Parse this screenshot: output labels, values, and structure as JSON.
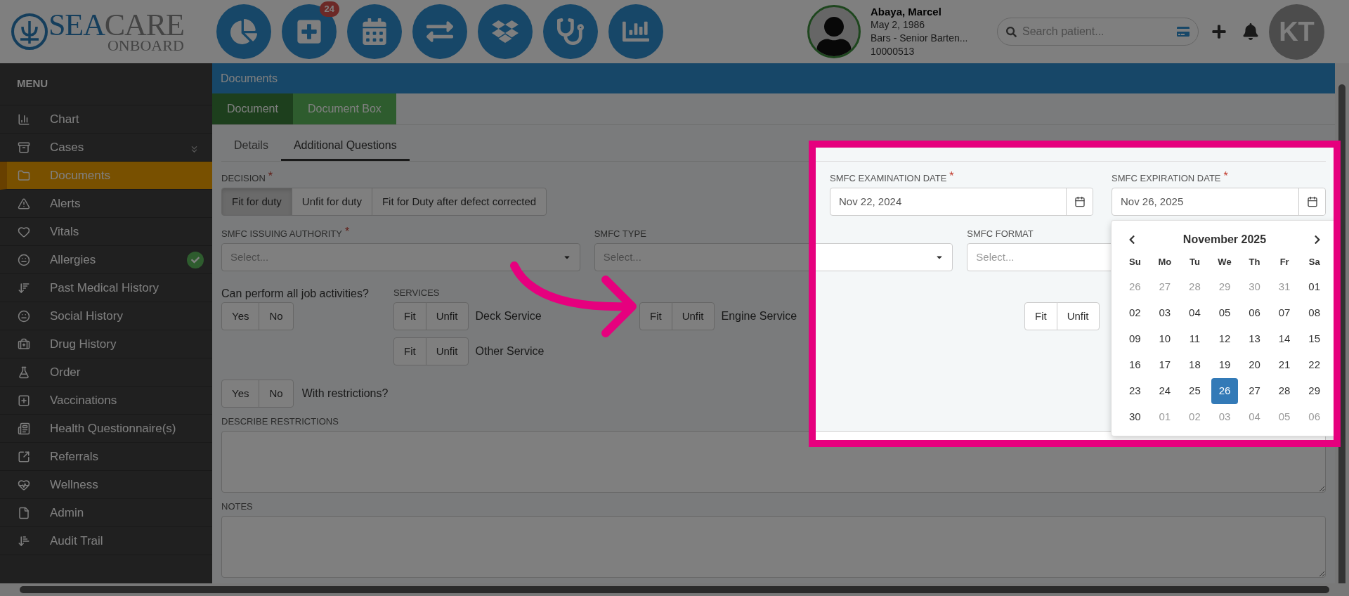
{
  "header": {
    "logo": {
      "first": "SEA",
      "second": "CARE",
      "sub": "ONBOARD"
    },
    "toolbar_badge": "24",
    "patient": {
      "name": "Abaya, Marcel",
      "dob": "May 2, 1986",
      "role": "Bars - Senior Barten...",
      "id": "10000513"
    },
    "search": {
      "placeholder": "Search patient..."
    },
    "user_initials": "KT"
  },
  "sidebar": {
    "title": "MENU",
    "items": [
      {
        "label": "Chart",
        "selected": false,
        "expandable": false,
        "checked": false
      },
      {
        "label": "Cases",
        "selected": false,
        "expandable": true,
        "checked": false
      },
      {
        "label": "Documents",
        "selected": true,
        "expandable": false,
        "checked": false
      },
      {
        "label": "Alerts",
        "selected": false,
        "expandable": false,
        "checked": false
      },
      {
        "label": "Vitals",
        "selected": false,
        "expandable": false,
        "checked": false
      },
      {
        "label": "Allergies",
        "selected": false,
        "expandable": false,
        "checked": true
      },
      {
        "label": "Past Medical History",
        "selected": false,
        "expandable": false,
        "checked": false
      },
      {
        "label": "Social History",
        "selected": false,
        "expandable": false,
        "checked": false
      },
      {
        "label": "Drug History",
        "selected": false,
        "expandable": false,
        "checked": false
      },
      {
        "label": "Order",
        "selected": false,
        "expandable": false,
        "checked": false
      },
      {
        "label": "Vaccinations",
        "selected": false,
        "expandable": false,
        "checked": false
      },
      {
        "label": "Health Questionnaire(s)",
        "selected": false,
        "expandable": false,
        "checked": false
      },
      {
        "label": "Referrals",
        "selected": false,
        "expandable": false,
        "checked": false
      },
      {
        "label": "Wellness",
        "selected": false,
        "expandable": false,
        "checked": false
      },
      {
        "label": "Admin",
        "selected": false,
        "expandable": false,
        "checked": false
      },
      {
        "label": "Audit Trail",
        "selected": false,
        "expandable": false,
        "checked": false
      }
    ]
  },
  "main": {
    "title": "Documents",
    "tabs": [
      {
        "label": "Document",
        "selected": true
      },
      {
        "label": "Document Box",
        "selected": false
      }
    ],
    "subtabs": [
      {
        "label": "Details",
        "selected": false
      },
      {
        "label": "Additional Questions",
        "selected": true
      }
    ],
    "form": {
      "decision": {
        "label": "DECISION",
        "required_mark": "*",
        "options": [
          {
            "label": "Fit for duty",
            "selected": true
          },
          {
            "label": "Unfit for duty",
            "selected": false
          },
          {
            "label": "Fit for Duty after defect corrected",
            "selected": false
          }
        ]
      },
      "examination_date": {
        "label": "SMFC EXAMINATION DATE",
        "required_mark": "*",
        "value": "Nov 22, 2024"
      },
      "expiration_date": {
        "label": "SMFC EXPIRATION DATE",
        "required_mark": "*",
        "value": "Nov 26, 2025"
      },
      "selects": [
        {
          "label": "SMFC ISSUING AUTHORITY",
          "required_mark": "*",
          "placeholder": "Select..."
        },
        {
          "label": "SMFC TYPE",
          "placeholder": "Select..."
        },
        {
          "label": "SMFC FORMAT",
          "placeholder": "Select..."
        }
      ],
      "can_perform": {
        "label": "Can perform all job activities?",
        "options": [
          {
            "label": "Yes",
            "selected": false
          },
          {
            "label": "No",
            "selected": false
          }
        ]
      },
      "services": {
        "label": "SERVICES",
        "groups": [
          {
            "label": "Deck Service",
            "options": [
              {
                "label": "Fit",
                "selected": false
              },
              {
                "label": "Unfit",
                "selected": false
              }
            ]
          },
          {
            "label": "Other Service",
            "options": [
              {
                "label": "Fit",
                "selected": false
              },
              {
                "label": "Unfit",
                "selected": false
              }
            ]
          },
          {
            "label": "Engine Service",
            "options": [
              {
                "label": "Fit",
                "selected": false
              },
              {
                "label": "Unfit",
                "selected": false
              }
            ]
          },
          {
            "options": [
              {
                "label": "Fit",
                "selected": false
              },
              {
                "label": "Unfit",
                "selected": false
              }
            ]
          }
        ]
      },
      "restrictions": {
        "label": "With restrictions?",
        "options": [
          {
            "label": "Yes",
            "selected": false
          },
          {
            "label": "No",
            "selected": false
          }
        ]
      },
      "describe_restrictions": {
        "label": "DESCRIBE RESTRICTIONS"
      },
      "notes": {
        "label": "NOTES"
      }
    },
    "calendar": {
      "month": "November 2025",
      "weekdays": [
        "Su",
        "Mo",
        "Tu",
        "We",
        "Th",
        "Fr",
        "Sa"
      ],
      "weeks": [
        [
          {
            "label": "26",
            "outside": true,
            "selected": false
          },
          {
            "label": "27",
            "outside": true,
            "selected": false
          },
          {
            "label": "28",
            "outside": true,
            "selected": false
          },
          {
            "label": "29",
            "outside": true,
            "selected": false
          },
          {
            "label": "30",
            "outside": true,
            "selected": false
          },
          {
            "label": "31",
            "outside": true,
            "selected": false
          },
          {
            "label": "01",
            "outside": false,
            "selected": false
          }
        ],
        [
          {
            "label": "02",
            "outside": false,
            "selected": false
          },
          {
            "label": "03",
            "outside": false,
            "selected": false
          },
          {
            "label": "04",
            "outside": false,
            "selected": false
          },
          {
            "label": "05",
            "outside": false,
            "selected": false
          },
          {
            "label": "06",
            "outside": false,
            "selected": false
          },
          {
            "label": "07",
            "outside": false,
            "selected": false
          },
          {
            "label": "08",
            "outside": false,
            "selected": false
          }
        ],
        [
          {
            "label": "09",
            "outside": false,
            "selected": false
          },
          {
            "label": "10",
            "outside": false,
            "selected": false
          },
          {
            "label": "11",
            "outside": false,
            "selected": false
          },
          {
            "label": "12",
            "outside": false,
            "selected": false
          },
          {
            "label": "13",
            "outside": false,
            "selected": false
          },
          {
            "label": "14",
            "outside": false,
            "selected": false
          },
          {
            "label": "15",
            "outside": false,
            "selected": false
          }
        ],
        [
          {
            "label": "16",
            "outside": false,
            "selected": false
          },
          {
            "label": "17",
            "outside": false,
            "selected": false
          },
          {
            "label": "18",
            "outside": false,
            "selected": false
          },
          {
            "label": "19",
            "outside": false,
            "selected": false
          },
          {
            "label": "20",
            "outside": false,
            "selected": false
          },
          {
            "label": "21",
            "outside": false,
            "selected": false
          },
          {
            "label": "22",
            "outside": false,
            "selected": false
          }
        ],
        [
          {
            "label": "23",
            "outside": false,
            "selected": false
          },
          {
            "label": "24",
            "outside": false,
            "selected": false
          },
          {
            "label": "25",
            "outside": false,
            "selected": false
          },
          {
            "label": "26",
            "outside": false,
            "selected": true
          },
          {
            "label": "27",
            "outside": false,
            "selected": false
          },
          {
            "label": "28",
            "outside": false,
            "selected": false
          },
          {
            "label": "29",
            "outside": false,
            "selected": false
          }
        ],
        [
          {
            "label": "30",
            "outside": false,
            "selected": false
          },
          {
            "label": "01",
            "outside": true,
            "selected": false
          },
          {
            "label": "02",
            "outside": true,
            "selected": false
          },
          {
            "label": "03",
            "outside": true,
            "selected": false
          },
          {
            "label": "04",
            "outside": true,
            "selected": false
          },
          {
            "label": "05",
            "outside": true,
            "selected": false
          },
          {
            "label": "06",
            "outside": true,
            "selected": false
          }
        ]
      ]
    }
  }
}
